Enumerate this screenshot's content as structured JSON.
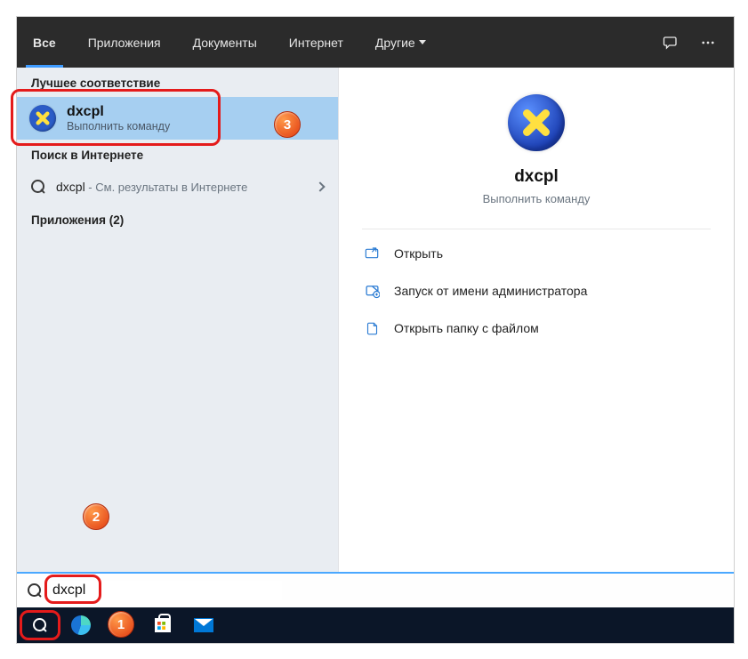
{
  "tabs": {
    "all": "Все",
    "apps": "Приложения",
    "docs": "Документы",
    "internet": "Интернет",
    "other": "Другие"
  },
  "left": {
    "best_header": "Лучшее соответствие",
    "best_title": "dxcpl",
    "best_sub": "Выполнить команду",
    "web_header": "Поиск в Интернете",
    "web_term": "dxcpl",
    "web_hint": " - См. результаты в Интернете",
    "apps_header": "Приложения (2)"
  },
  "detail": {
    "title": "dxcpl",
    "sub": "Выполнить команду",
    "open": "Открыть",
    "run_admin": "Запуск от имени администратора",
    "open_folder": "Открыть папку с файлом"
  },
  "search": {
    "value": "dxcpl"
  }
}
